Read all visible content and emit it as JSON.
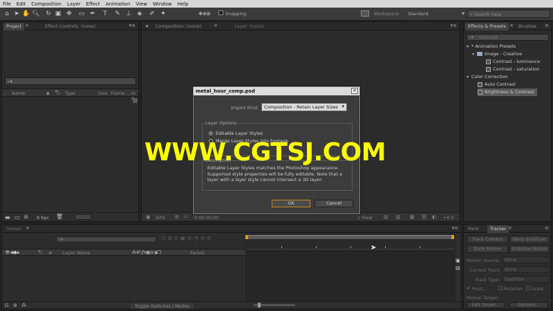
{
  "menu": [
    "File",
    "Edit",
    "Composition",
    "Layer",
    "Effect",
    "Animation",
    "View",
    "Window",
    "Help"
  ],
  "toolbar": {
    "snapping_label": "Snapping",
    "workspace_label": "Workspace:",
    "workspace_value": "Standard",
    "search_placeholder": "Search Help"
  },
  "project_panel": {
    "tab_project": "Project",
    "tab_effect_controls": "Effect Controls: (none)",
    "search_hint": "⌕▾",
    "col_name": "Name",
    "col_type": "Type",
    "col_size": "Size",
    "col_frame": "Frame ...",
    "col_in": "In P",
    "bpc": "8 bpc"
  },
  "composition_panel": {
    "tab_composition": "Composition: (none)",
    "tab_layer": "Layer: (none)",
    "zoom": "50%",
    "timecode": "0;00;00;00",
    "view": "1 View",
    "exposure": "+0.0"
  },
  "effects_panel": {
    "tab_effects": "Effects & Presets",
    "tab_brushes": "Brushes",
    "search_value": "contrast",
    "tree": [
      {
        "label": "* Animation Presets",
        "level": 0,
        "kind": "folder-open",
        "selected": false
      },
      {
        "label": "Image - Creative",
        "level": 1,
        "kind": "folder",
        "selected": false
      },
      {
        "label": "Contrast - luminance",
        "level": 2,
        "kind": "preset",
        "selected": false
      },
      {
        "label": "Contrast - saturation",
        "level": 2,
        "kind": "preset",
        "selected": false
      },
      {
        "label": "Color Correction",
        "level": 0,
        "kind": "folder",
        "selected": false
      },
      {
        "label": "Auto Contrast",
        "level": 1,
        "kind": "effect",
        "selected": false
      },
      {
        "label": "Brightness & Contrast",
        "level": 1,
        "kind": "effect",
        "selected": true
      }
    ]
  },
  "timeline_panel": {
    "tab_none": "(none)",
    "col_layer_name": "Layer Name",
    "col_parent": "Parent",
    "hash": "#",
    "toggle_label": "Toggle Switches / Modes"
  },
  "tracker_panel": {
    "tab_paint": "Paint",
    "tab_tracker": "Tracker",
    "track_camera": "Track Camera",
    "warp_stabilizer": "Warp Stabilizer",
    "track_motion": "Track Motion",
    "stabilize_motion": "Stabilize Motion",
    "motion_source_label": "Motion Source:",
    "motion_source_value": "None",
    "current_track_label": "Current Track:",
    "current_track_value": "None",
    "track_type_label": "Track Type:",
    "track_type_value": "Stabilize",
    "position_label": "Posit...",
    "rotation_label": "Rotation",
    "scale_label": "Scale",
    "motion_target_label": "Motion Target:",
    "edit_target": "Edit Target...",
    "options": "Options..."
  },
  "dialog": {
    "title": "metal_hour_comp.psd",
    "import_kind_label": "Import Kind:",
    "import_kind_value": "Composition - Retain Layer Sizes",
    "layer_options_title": "Layer Options",
    "option_editable": "Editable Layer Styles",
    "option_merge": "Merge Layer Styles into Footage",
    "description_title": "Description",
    "description_text": "Editable Layer Styles matches the Photoshop appearance. Supported style properties will be fully editable. Note that a layer with a layer style cannot intersect a 3D layer.",
    "ok_label": "OK",
    "cancel_label": "Cancel"
  },
  "watermark": "WWW.CGTSJ.COM"
}
